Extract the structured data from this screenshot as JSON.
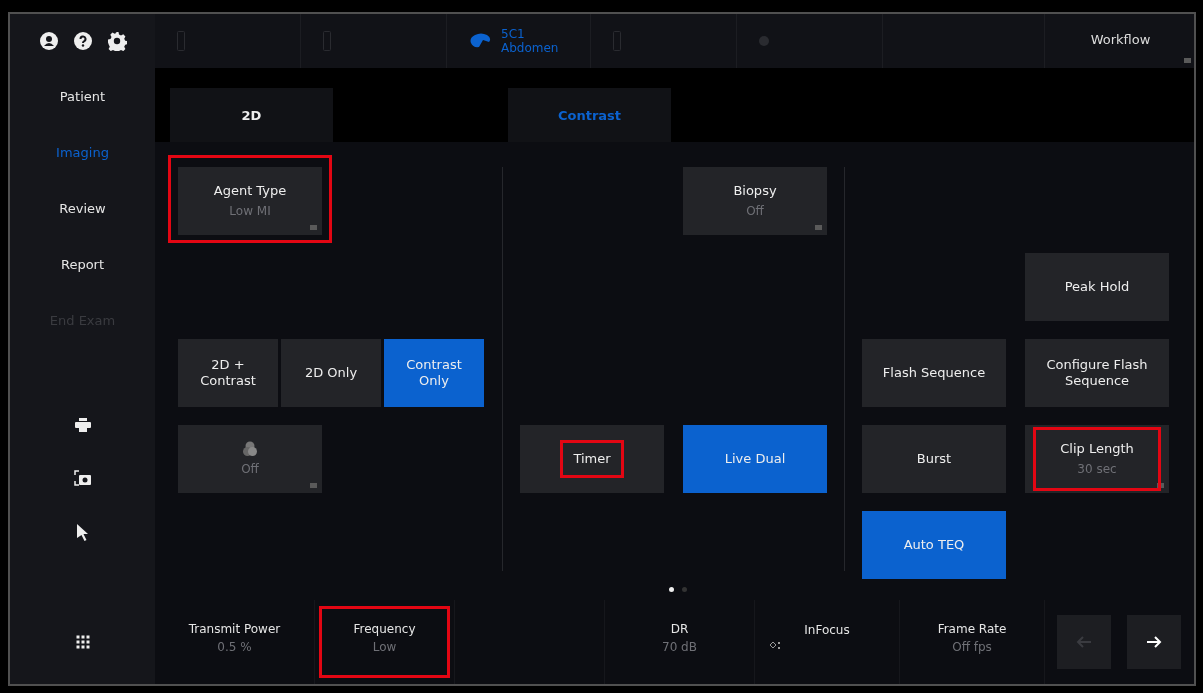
{
  "header_icons": [
    {
      "kind": "user"
    },
    {
      "kind": "help"
    },
    {
      "kind": "settings"
    }
  ],
  "probe_slots": [
    {
      "kind": "empty"
    },
    {
      "kind": "empty"
    },
    {
      "kind": "probe",
      "name": "5C1",
      "preset": "Abdomen"
    },
    {
      "kind": "empty"
    },
    {
      "kind": "dot"
    },
    {
      "kind": "blank"
    }
  ],
  "workflow": {
    "label": "Workflow",
    "menu": true
  },
  "sidebar": {
    "items": [
      {
        "label": "Patient",
        "selected": false,
        "disabled": false
      },
      {
        "label": "Imaging",
        "selected": true,
        "disabled": false
      },
      {
        "label": "Review",
        "selected": false,
        "disabled": false
      },
      {
        "label": "Report",
        "selected": false,
        "disabled": false
      },
      {
        "label": "End Exam",
        "selected": false,
        "disabled": true
      }
    ],
    "tools": [
      {
        "kind": "print"
      },
      {
        "kind": "camera"
      },
      {
        "kind": "pointer"
      }
    ]
  },
  "tabs": [
    {
      "label": "2D",
      "selected": false
    },
    {
      "label": "Contrast",
      "selected": true
    }
  ],
  "panels": [
    {
      "controls": [
        {
          "kind": "tile",
          "label": "Agent Type",
          "value": "Low MI",
          "menu": true,
          "selected": false,
          "highlighted": true
        },
        {
          "kind": "segmented",
          "options": [
            {
              "label": "2D +\nContrast",
              "selected": false
            },
            {
              "label": "2D Only",
              "selected": false
            },
            {
              "label": "Contrast\nOnly",
              "selected": true
            }
          ]
        },
        {
          "kind": "icon-tile",
          "value": "Off",
          "menu": true,
          "selected": false
        }
      ]
    },
    {
      "controls": [
        {
          "kind": "tile",
          "label": "Biopsy",
          "value": "Off",
          "menu": true,
          "selected": false
        },
        {
          "kind": "tile",
          "label": "Timer",
          "menu": false,
          "selected": false,
          "highlighted": true
        },
        {
          "kind": "tile",
          "label": "Live Dual",
          "menu": false,
          "selected": true
        }
      ]
    },
    {
      "controls": [
        {
          "kind": "tile",
          "label": "Peak Hold",
          "menu": false,
          "selected": false
        },
        {
          "kind": "tile",
          "label": "Flash Sequence",
          "menu": false,
          "selected": false
        },
        {
          "kind": "tile",
          "label": "Configure Flash\nSequence",
          "menu": false,
          "selected": false
        },
        {
          "kind": "tile",
          "label": "Burst",
          "menu": false,
          "selected": false
        },
        {
          "kind": "tile",
          "label": "Clip Length",
          "value": "30 sec",
          "menu": true,
          "selected": false,
          "highlighted": true
        },
        {
          "kind": "tile",
          "label": "Auto TEQ",
          "menu": false,
          "selected": true
        }
      ]
    }
  ],
  "pages": [
    {
      "selected": true
    },
    {
      "selected": false
    }
  ],
  "bottom_bar": {
    "items": [
      {
        "kind": "reading",
        "label": "Transmit Power",
        "value": "0.5 %"
      },
      {
        "kind": "reading",
        "label": "Frequency",
        "value": "Low",
        "highlighted": true
      },
      {
        "kind": "blank"
      },
      {
        "kind": "reading",
        "label": "DR",
        "value": "70 dB"
      },
      {
        "kind": "icon",
        "label": "InFocus"
      },
      {
        "kind": "reading",
        "label": "Frame Rate",
        "value": "Off fps"
      }
    ],
    "back_disabled": true,
    "forward_disabled": false
  }
}
